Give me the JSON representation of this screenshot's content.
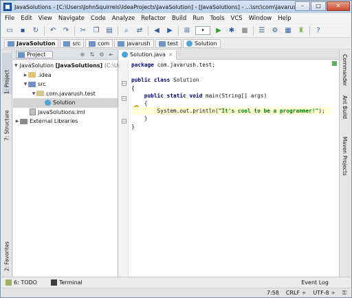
{
  "window": {
    "title": "JavaSolutions - [C:\\Users\\JohnSquirrels\\IdeaProjects\\JavaSolution] - [JavaSolutions] - ...\\src\\com\\javarush\\test\\Solution.j...",
    "min_label": "–",
    "max_label": "□",
    "close_label": "✕"
  },
  "menu": [
    "File",
    "Edit",
    "View",
    "Navigate",
    "Code",
    "Analyze",
    "Refactor",
    "Build",
    "Run",
    "Tools",
    "VCS",
    "Window",
    "Help"
  ],
  "toolbar": {
    "icons": [
      "folder-open-icon",
      "save-icon",
      "sync-icon",
      "undo-icon",
      "redo-icon",
      "cut-icon",
      "copy-icon",
      "paste-icon",
      "find-icon",
      "replace-icon",
      "back-icon",
      "forward-icon",
      "make-icon",
      "run-config-combo",
      "run-icon",
      "debug-icon",
      "stop-icon",
      "structure-icon",
      "settings-icon",
      "project-structure-icon",
      "android-icon",
      "help-icon"
    ],
    "run_combo_label": "▾"
  },
  "breadcrumbs": [
    "JavaSolution",
    "src",
    "com",
    "javarush",
    "test",
    "Solution"
  ],
  "left_strip": {
    "project_tab": "1: Project",
    "structure_tab": "7: Structure",
    "favorites_tab": "2: Favorites"
  },
  "right_strip": {
    "commander_tab": "Commander",
    "ant_build_tab": "Ant Build",
    "maven_tab": "Maven Projects"
  },
  "project_panel": {
    "view_label": "Project"
  },
  "tree": [
    {
      "label": "JavaSolution",
      "bold_suffix": "[JavaSolutions]",
      "path": "(C:\\Us",
      "indent": 0,
      "expanded": true,
      "icon": "folder"
    },
    {
      "label": ".idea",
      "indent": 1,
      "expanded": false,
      "icon": "folder"
    },
    {
      "label": "src",
      "indent": 1,
      "expanded": true,
      "icon": "source-folder"
    },
    {
      "label": "com.javarush.test",
      "indent": 2,
      "expanded": true,
      "icon": "package"
    },
    {
      "label": "Solution",
      "indent": 3,
      "selected": true,
      "icon": "class"
    },
    {
      "label": "JavaSolutions.iml",
      "indent": 1,
      "icon": "iml-file"
    },
    {
      "label": "External Libraries",
      "indent": 0,
      "expanded": false,
      "icon": "library"
    }
  ],
  "editor": {
    "tab_label": "Solution.java",
    "code_lines": [
      "package com.javarush.test;",
      "",
      "public class Solution",
      "{",
      "    public static void main(String[] args)",
      "    {",
      "        System.out.println(\"It's cool to be a programmer!\");",
      "    }",
      "}"
    ],
    "highlighted_line": 6
  },
  "bottom_tools": {
    "todo_label": "6: TODO",
    "terminal_label": "Terminal",
    "event_log_label": "Event Log"
  },
  "status": {
    "position": "7:58",
    "line_separator": "CRLF ÷",
    "encoding": "UTF-8 ÷"
  },
  "colors": {
    "selection": "#d4d4d4",
    "line_highlight": "#ffffd8",
    "keyword": "#000080",
    "string": "#008000"
  }
}
